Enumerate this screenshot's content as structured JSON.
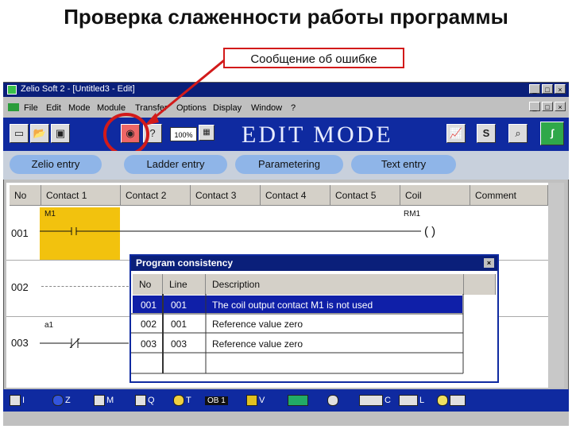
{
  "slide": {
    "title": "Проверка слаженности работы программы",
    "callout": "Сообщение об ошибке",
    "highlight_color": "#d21a1a"
  },
  "window": {
    "title": "Zelio Soft 2 - [Untitled3 - Edit]",
    "menu": [
      "File",
      "Edit",
      "Mode",
      "Module",
      "Transfer",
      "Options",
      "Display",
      "Window",
      "?"
    ],
    "zoom": "100%",
    "mode_banner": "EDIT MODE",
    "toolbar_icons": [
      "new-icon",
      "open-icon",
      "save-icon",
      "eye-icon",
      "help-icon",
      "zoom-box",
      "chart-icon",
      "s-icon",
      "find-icon",
      "logo-icon"
    ]
  },
  "tabs": [
    "Zelio entry",
    "Ladder entry",
    "Parametering",
    "Text entry"
  ],
  "grid": {
    "columns": [
      "No",
      "Contact 1",
      "Contact 2",
      "Contact 3",
      "Contact 4",
      "Contact 5",
      "Coil",
      "Comment"
    ],
    "rows": [
      {
        "no": "001",
        "contact1": "M1",
        "coil_label": "RM1",
        "coil_symbol": "( )"
      },
      {
        "no": "002"
      },
      {
        "no": "003",
        "contact1": "a1"
      }
    ]
  },
  "dialog": {
    "title": "Program consistency",
    "columns": [
      "No",
      "Line",
      "Description"
    ],
    "rows": [
      {
        "no": "001",
        "line": "001",
        "description": "The coil output contact M1 is not used"
      },
      {
        "no": "002",
        "line": "001",
        "description": "Reference value zero"
      },
      {
        "no": "003",
        "line": "003",
        "description": "Reference value zero"
      }
    ]
  },
  "bottom_tools": [
    "I",
    "Z",
    "M",
    "Q",
    "T",
    "OB 1",
    "V",
    "C",
    "L"
  ]
}
